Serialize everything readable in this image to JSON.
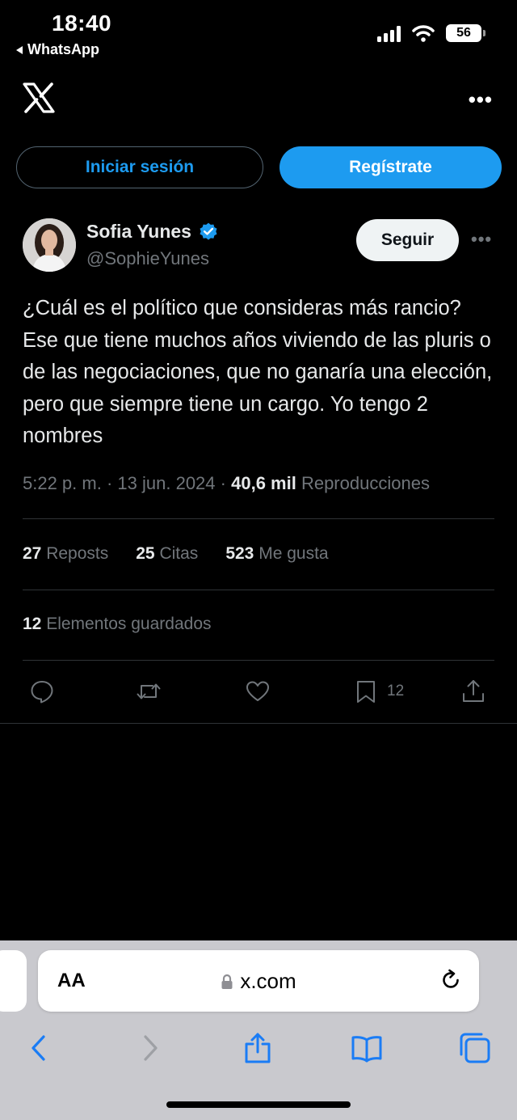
{
  "status_bar": {
    "time": "18:40",
    "back_app": "WhatsApp",
    "battery": "56"
  },
  "header": {
    "logo": "x-logo",
    "more_icon": "more-horizontal-icon"
  },
  "auth": {
    "login_label": "Iniciar sesión",
    "signup_label": "Regístrate"
  },
  "tweet": {
    "author_name": "Sofia Yunes",
    "author_handle": "@SophieYunes",
    "follow_label": "Seguir",
    "text": "¿Cuál es el político que consideras más rancio? Ese que tiene muchos años viviendo de las pluris o de las negociaciones, que no ganaría una elección, pero que siempre tiene un cargo. Yo tengo 2 nombres",
    "time": "5:22 p. m.",
    "date": "13 jun. 2024",
    "views_count": "40,6 mil",
    "views_label": "Reproducciones",
    "reposts_count": "27",
    "reposts_label": "Reposts",
    "quotes_count": "25",
    "quotes_label": "Citas",
    "likes_count": "523",
    "likes_label": "Me gusta",
    "bookmarks_count": "12",
    "bookmarks_label": "Elementos guardados",
    "action_bookmark_count": "12"
  },
  "browser": {
    "aa_label": "AA",
    "url": "x.com"
  },
  "colors": {
    "accent": "#1d9bf0",
    "background": "#000000",
    "muted": "#71767b",
    "divider": "#2f3336",
    "safari_blue": "#1a7cf5"
  }
}
